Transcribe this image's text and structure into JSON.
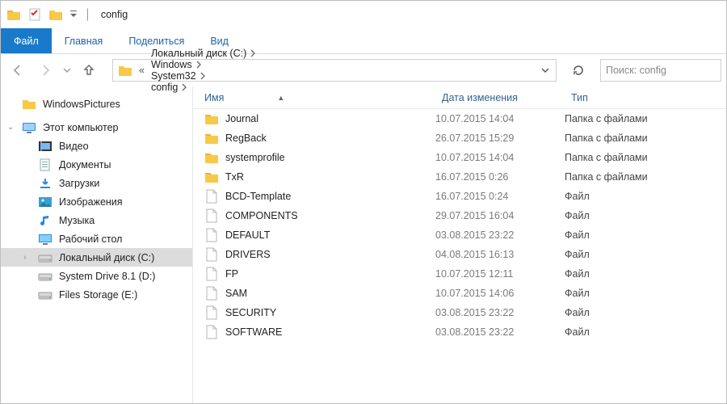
{
  "window": {
    "title": "config"
  },
  "ribbon": {
    "file": "Файл",
    "tabs": [
      "Главная",
      "Поделиться",
      "Вид"
    ]
  },
  "crumbs": [
    "Локальный диск (C:)",
    "Windows",
    "System32",
    "config"
  ],
  "search": {
    "placeholder": "Поиск: config"
  },
  "nav": {
    "quick": [
      {
        "label": "WindowsPictures",
        "icon": "folder"
      }
    ],
    "thispc_label": "Этот компьютер",
    "thispc_children": [
      {
        "label": "Видео",
        "icon": "video"
      },
      {
        "label": "Документы",
        "icon": "docs"
      },
      {
        "label": "Загрузки",
        "icon": "downloads"
      },
      {
        "label": "Изображения",
        "icon": "pictures"
      },
      {
        "label": "Музыка",
        "icon": "music"
      },
      {
        "label": "Рабочий стол",
        "icon": "desktop"
      },
      {
        "label": "Локальный диск (C:)",
        "icon": "drive",
        "selected": true
      },
      {
        "label": "System Drive 8.1 (D:)",
        "icon": "drive"
      },
      {
        "label": "Files Storage (E:)",
        "icon": "drive"
      }
    ]
  },
  "columns": {
    "name": "Имя",
    "date": "Дата изменения",
    "type": "Тип"
  },
  "type_labels": {
    "folder": "Папка с файлами",
    "file": "Файл"
  },
  "files": [
    {
      "name": "Journal",
      "date": "10.07.2015 14:04",
      "kind": "folder"
    },
    {
      "name": "RegBack",
      "date": "26.07.2015 15:29",
      "kind": "folder"
    },
    {
      "name": "systemprofile",
      "date": "10.07.2015 14:04",
      "kind": "folder"
    },
    {
      "name": "TxR",
      "date": "16.07.2015 0:26",
      "kind": "folder"
    },
    {
      "name": "BCD-Template",
      "date": "16.07.2015 0:24",
      "kind": "file"
    },
    {
      "name": "COMPONENTS",
      "date": "29.07.2015 16:04",
      "kind": "file"
    },
    {
      "name": "DEFAULT",
      "date": "03.08.2015 23:22",
      "kind": "file"
    },
    {
      "name": "DRIVERS",
      "date": "04.08.2015 16:13",
      "kind": "file"
    },
    {
      "name": "FP",
      "date": "10.07.2015 12:11",
      "kind": "file"
    },
    {
      "name": "SAM",
      "date": "10.07.2015 14:06",
      "kind": "file"
    },
    {
      "name": "SECURITY",
      "date": "03.08.2015 23:22",
      "kind": "file"
    },
    {
      "name": "SOFTWARE",
      "date": "03.08.2015 23:22",
      "kind": "file"
    }
  ]
}
